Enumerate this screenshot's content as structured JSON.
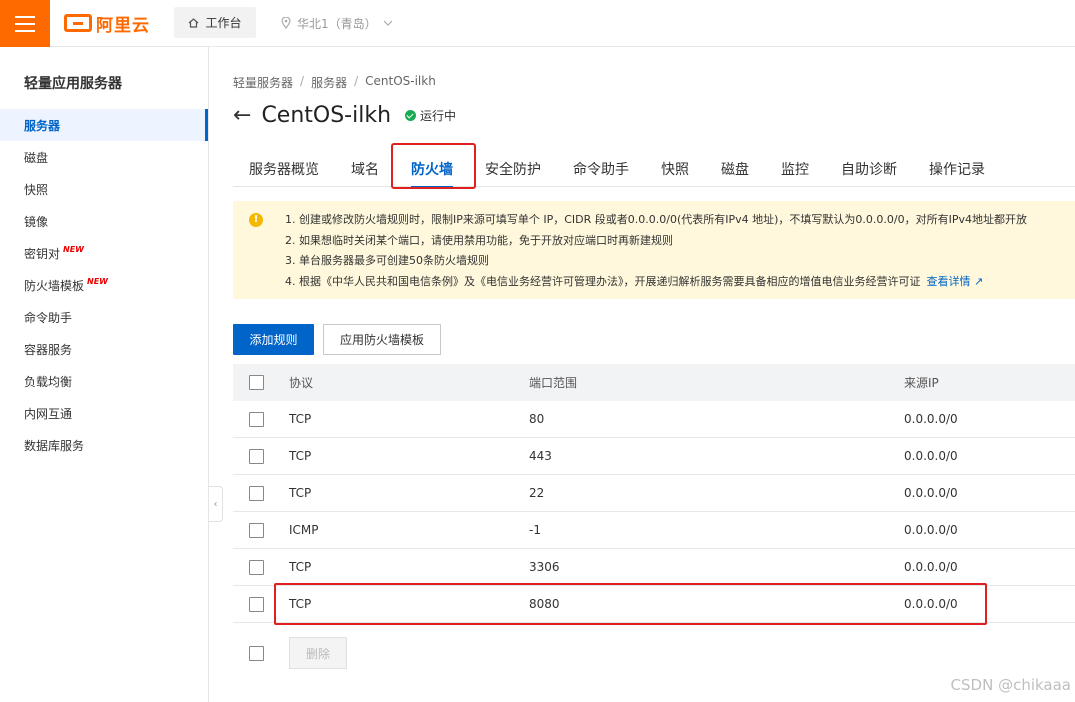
{
  "topbar": {
    "logo_text": "阿里云",
    "workbench_label": "工作台",
    "region_label": "华北1（青岛）",
    "brand_color": "#ff6a00"
  },
  "sidebar": {
    "title": "轻量应用服务器",
    "items": [
      {
        "label": "服务器",
        "active": true,
        "new": false
      },
      {
        "label": "磁盘",
        "new": false
      },
      {
        "label": "快照",
        "new": false
      },
      {
        "label": "镜像",
        "new": false
      },
      {
        "label": "密钥对",
        "new": true
      },
      {
        "label": "防火墙模板",
        "new": true
      },
      {
        "label": "命令助手",
        "new": false
      },
      {
        "label": "容器服务",
        "new": false
      },
      {
        "label": "负载均衡",
        "new": false
      },
      {
        "label": "内网互通",
        "new": false
      },
      {
        "label": "数据库服务",
        "new": false
      }
    ],
    "new_badge": "NEW",
    "collapse_icon": "‹"
  },
  "breadcrumb": [
    "轻量服务器",
    "服务器",
    "CentOS-ilkh"
  ],
  "breadcrumb_sep": "/",
  "header": {
    "back_icon": "←",
    "title": "CentOS-ilkh",
    "status": "运行中",
    "status_color": "#1aaa55"
  },
  "tabs": [
    "服务器概览",
    "域名",
    "防火墙",
    "安全防护",
    "命令助手",
    "快照",
    "磁盘",
    "监控",
    "自助诊断",
    "操作记录"
  ],
  "active_tab": "防火墙",
  "notice": {
    "icon": "!",
    "lines": [
      "1. 创建或修改防火墙规则时，限制IP来源可填写单个 IP，CIDR 段或者0.0.0.0/0(代表所有IPv4 地址)，不填写默认为0.0.0.0/0，对所有IPv4地址都开放",
      "2. 如果想临时关闭某个端口，请使用禁用功能，免于开放对应端口时再新建规则",
      "3. 单台服务器最多可创建50条防火墙规则",
      "4. 根据《中华人民共和国电信条例》及《电信业务经营许可管理办法》，开展递归解析服务需要具备相应的增值电信业务经营许可证"
    ],
    "link_label": "查看详情 ↗"
  },
  "actions": {
    "add_rule": "添加规则",
    "apply_template": "应用防火墙模板",
    "delete": "删除"
  },
  "table": {
    "columns": [
      "协议",
      "端口范围",
      "来源IP"
    ],
    "rows": [
      {
        "protocol": "TCP",
        "port": "80",
        "source": "0.0.0.0/0"
      },
      {
        "protocol": "TCP",
        "port": "443",
        "source": "0.0.0.0/0"
      },
      {
        "protocol": "TCP",
        "port": "22",
        "source": "0.0.0.0/0"
      },
      {
        "protocol": "ICMP",
        "port": "-1",
        "source": "0.0.0.0/0"
      },
      {
        "protocol": "TCP",
        "port": "3306",
        "source": "0.0.0.0/0"
      },
      {
        "protocol": "TCP",
        "port": "8080",
        "source": "0.0.0.0/0"
      }
    ]
  },
  "watermark": "CSDN @chikaaa"
}
